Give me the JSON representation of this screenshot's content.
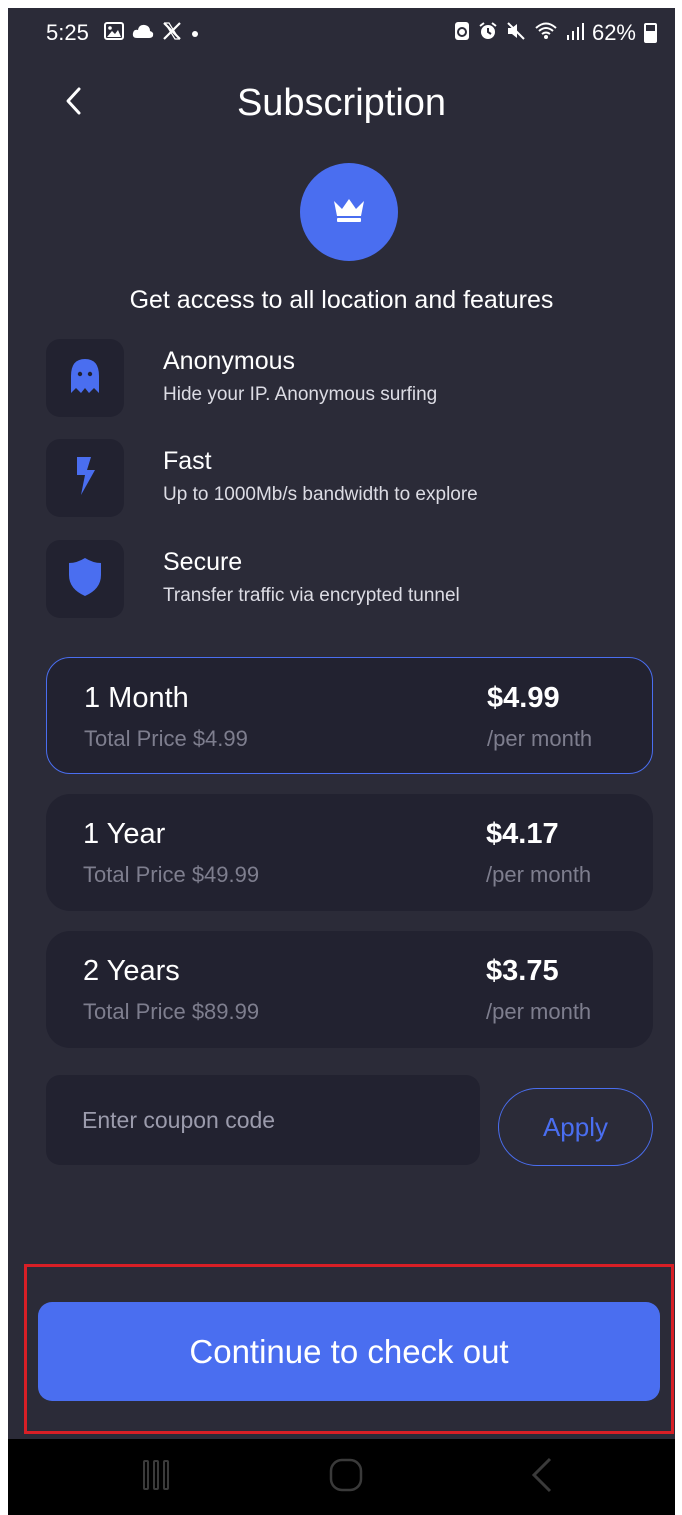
{
  "status_bar": {
    "time": "5:25",
    "battery_pct": "62%",
    "left_icons": [
      "gallery-icon",
      "cloud-icon",
      "x-icon",
      "dot-icon"
    ],
    "right_icons": [
      "recycle-icon",
      "alarm-icon",
      "mute-icon",
      "wifi-icon",
      "signal-icon",
      "battery-icon"
    ]
  },
  "header": {
    "title": "Subscription"
  },
  "hero": {
    "icon": "crown-icon",
    "headline": "Get access to all location and features"
  },
  "features": [
    {
      "icon": "ghost-icon",
      "title": "Anonymous",
      "desc": "Hide your IP. Anonymous surfing"
    },
    {
      "icon": "lightning-icon",
      "title": "Fast",
      "desc": "Up to 1000Mb/s bandwidth to explore"
    },
    {
      "icon": "shield-icon",
      "title": "Secure",
      "desc": "Transfer traffic via encrypted tunnel"
    }
  ],
  "plans": [
    {
      "name": "1 Month",
      "total": "Total Price $4.99",
      "price": "$4.99",
      "per": "/per month",
      "selected": true
    },
    {
      "name": "1 Year",
      "total": "Total Price $49.99",
      "price": "$4.17",
      "per": "/per month",
      "selected": false
    },
    {
      "name": "2 Years",
      "total": "Total Price $89.99",
      "price": "$3.75",
      "per": "/per month",
      "selected": false
    }
  ],
  "coupon": {
    "placeholder": "Enter coupon code",
    "value": "",
    "apply_label": "Apply"
  },
  "cta": {
    "label": "Continue to check out"
  },
  "colors": {
    "background": "#2b2b38",
    "card": "#222230",
    "accent": "#4a6ef0",
    "muted_text": "#7e7e8e",
    "highlight": "#d81f26"
  },
  "nav_bar": {
    "icons": [
      "recent-apps-icon",
      "home-icon",
      "back-nav-icon"
    ]
  }
}
